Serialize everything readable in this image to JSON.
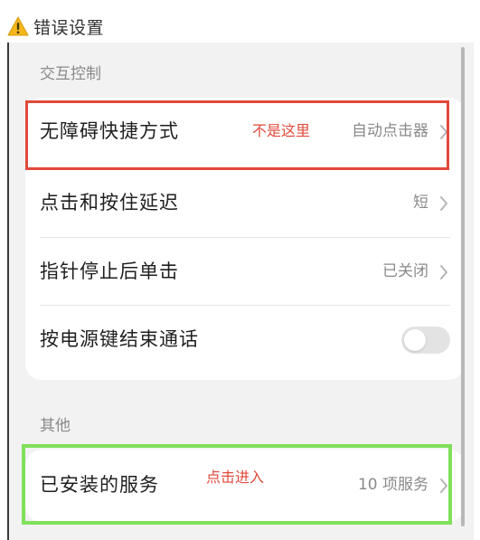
{
  "header": {
    "title": "错误设置",
    "icon": "warning-icon"
  },
  "sections": {
    "interaction": {
      "title": "交互控制"
    },
    "other": {
      "title": "其他"
    }
  },
  "rows": {
    "accessibility_shortcut": {
      "label": "无障碍快捷方式",
      "value": "自动点击器"
    },
    "touch_hold_delay": {
      "label": "点击和按住延迟",
      "value": "短"
    },
    "dwell_click": {
      "label": "指针停止后单击",
      "value": "已关闭"
    },
    "power_button_end_call": {
      "label": "按电源键结束通话",
      "toggle_on": false
    },
    "installed_services": {
      "label": "已安装的服务",
      "value": "10 项服务"
    }
  },
  "annotations": {
    "wrong": {
      "text": "不是这里",
      "color": "#e04a3a"
    },
    "correct": {
      "text": "点击进入",
      "color": "#e04a3a",
      "box_color": "#7fe05a"
    }
  }
}
